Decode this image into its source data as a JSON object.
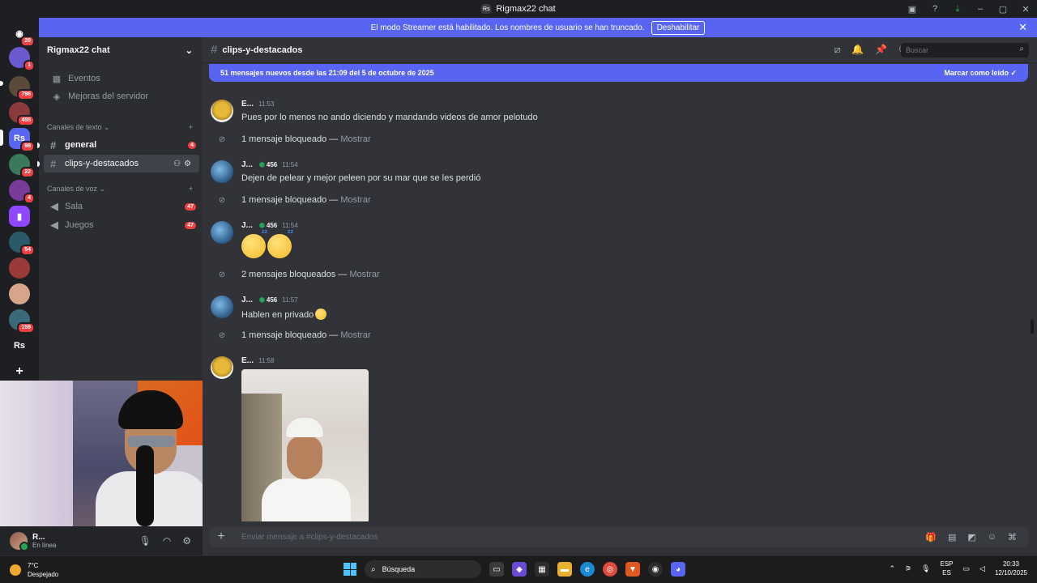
{
  "window": {
    "title": "Rigmax22 chat",
    "app_icon_text": "Rs"
  },
  "streamer_banner": {
    "text": "El modo Streamer está habilitado. Los nombres de usuario se han truncado.",
    "disable_label": "Deshabilitar"
  },
  "servers": [
    {
      "label": "",
      "badge": "28",
      "color": "#1e1f22"
    },
    {
      "label": "",
      "badge": "1",
      "color": "#6a5acd"
    },
    {
      "label": "",
      "badge": "796",
      "color": "#5a4a3a"
    },
    {
      "label": "",
      "badge": "455",
      "color": "#8a3a3a"
    },
    {
      "label": "Rs",
      "badge": "98",
      "color": "#5865f2"
    },
    {
      "label": "",
      "badge": "22",
      "color": "#3a7a5a"
    },
    {
      "label": "",
      "badge": "4",
      "color": "#7a3a9a"
    },
    {
      "label": "",
      "badge": "",
      "color": "#9146ff"
    },
    {
      "label": "",
      "badge": "54",
      "color": "#2a5a6a"
    },
    {
      "label": "",
      "badge": "",
      "color": "#9a3a3a"
    },
    {
      "label": "",
      "badge": "",
      "color": "#d6a58a"
    },
    {
      "label": "",
      "badge": "159",
      "color": "#3a6a7a"
    },
    {
      "label": "Rs",
      "badge": "",
      "color": "#1e1f22"
    }
  ],
  "sidebar": {
    "guild_name": "Rigmax22 chat",
    "items": [
      {
        "label": "Eventos",
        "icon": "calendar-icon"
      },
      {
        "label": "Mejoras del servidor",
        "icon": "boost-icon"
      }
    ],
    "text_category": "Canales de texto",
    "text_channels": [
      {
        "name": "general",
        "count": "4"
      },
      {
        "name": "clips-y-destacados",
        "count": ""
      }
    ],
    "voice_category": "Canales de voz",
    "voice_channels": [
      {
        "name": "Sala",
        "count": "47"
      },
      {
        "name": "Juegos",
        "count": "47"
      }
    ]
  },
  "user": {
    "name": "R...",
    "status": "En línea"
  },
  "channel": {
    "name": "clips-y-destacados",
    "search_placeholder": "Buscar"
  },
  "new_messages_bar": {
    "text": "51 mensajes nuevos desde las 21:09 del 5 de octubre de 2025",
    "mark_read": "Marcar como leído"
  },
  "messages": [
    {
      "author": "E...",
      "time": "11:53",
      "text": "Pues por lo menos no ando diciendo y mandando videos de amor pelotudo",
      "role": ""
    },
    {
      "blocked": "1 mensaje bloqueado",
      "show": "Mostrar"
    },
    {
      "author": "J...",
      "role": "456",
      "time": "11:54",
      "text": "Dejen de pelear y mejor peleen por su mar que se les perdió"
    },
    {
      "blocked": "1 mensaje bloqueado",
      "show": "Mostrar"
    },
    {
      "author": "J...",
      "role": "456",
      "time": "11:54",
      "text": ""
    },
    {
      "blocked": "2 mensajes bloqueados",
      "show": "Mostrar"
    },
    {
      "author": "J...",
      "role": "456",
      "time": "11:57",
      "text": "Hablen en privado"
    },
    {
      "blocked": "1 mensaje bloqueado",
      "show": "Mostrar"
    },
    {
      "author": "E...",
      "time": "11:58",
      "text": "",
      "role": ""
    }
  ],
  "composer": {
    "placeholder": "Enviar mensaje a #clips-y-destacados"
  },
  "taskbar": {
    "temp": "7°C",
    "weather": "Despejado",
    "search": "Búsqueda",
    "lang_top": "ESP",
    "lang_bottom": "ES",
    "time": "20:33",
    "date": "12/10/2025"
  },
  "colors": {
    "blurple": "#5865f2",
    "red_badge": "#f23f42",
    "online": "#23a55a"
  }
}
